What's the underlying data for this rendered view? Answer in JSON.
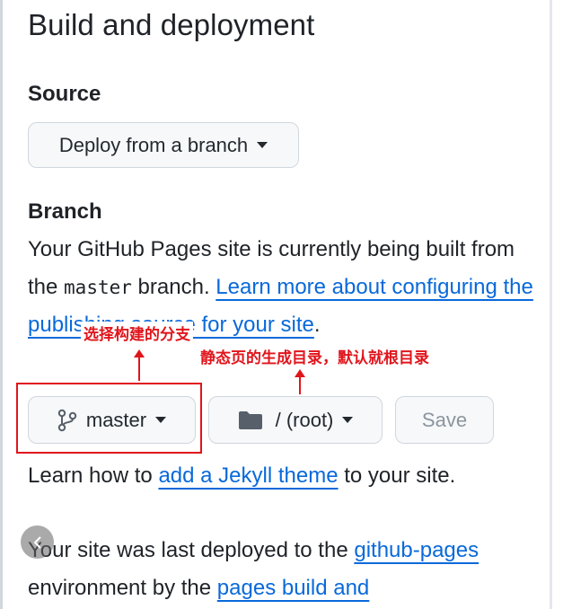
{
  "page_title": "Build and deployment",
  "source": {
    "heading": "Source",
    "dropdown_label": "Deploy from a branch"
  },
  "branch": {
    "heading": "Branch",
    "text_before": "Your GitHub Pages site is currently being built from the ",
    "branch_code": "master",
    "text_mid": " branch. ",
    "link_text": "Learn more about configuring the publishing source for your site",
    "text_after": ".",
    "branch_button": "master",
    "folder_button": "/ (root)",
    "save_button": "Save"
  },
  "theme_line": {
    "before": "Learn how to ",
    "link": "add a Jekyll theme",
    "after": " to your site."
  },
  "deploy_line": {
    "before": "Your site was last deployed to the ",
    "link1": "github-pages",
    "middle": " environment by the ",
    "link2": "pages build and"
  },
  "annotations": {
    "branch_note": "选择构建的分支",
    "dir_note": "静态页的生成目录，默认就根目录"
  },
  "colors": {
    "link": "#0969da",
    "annotation_red": "#e0151c"
  }
}
